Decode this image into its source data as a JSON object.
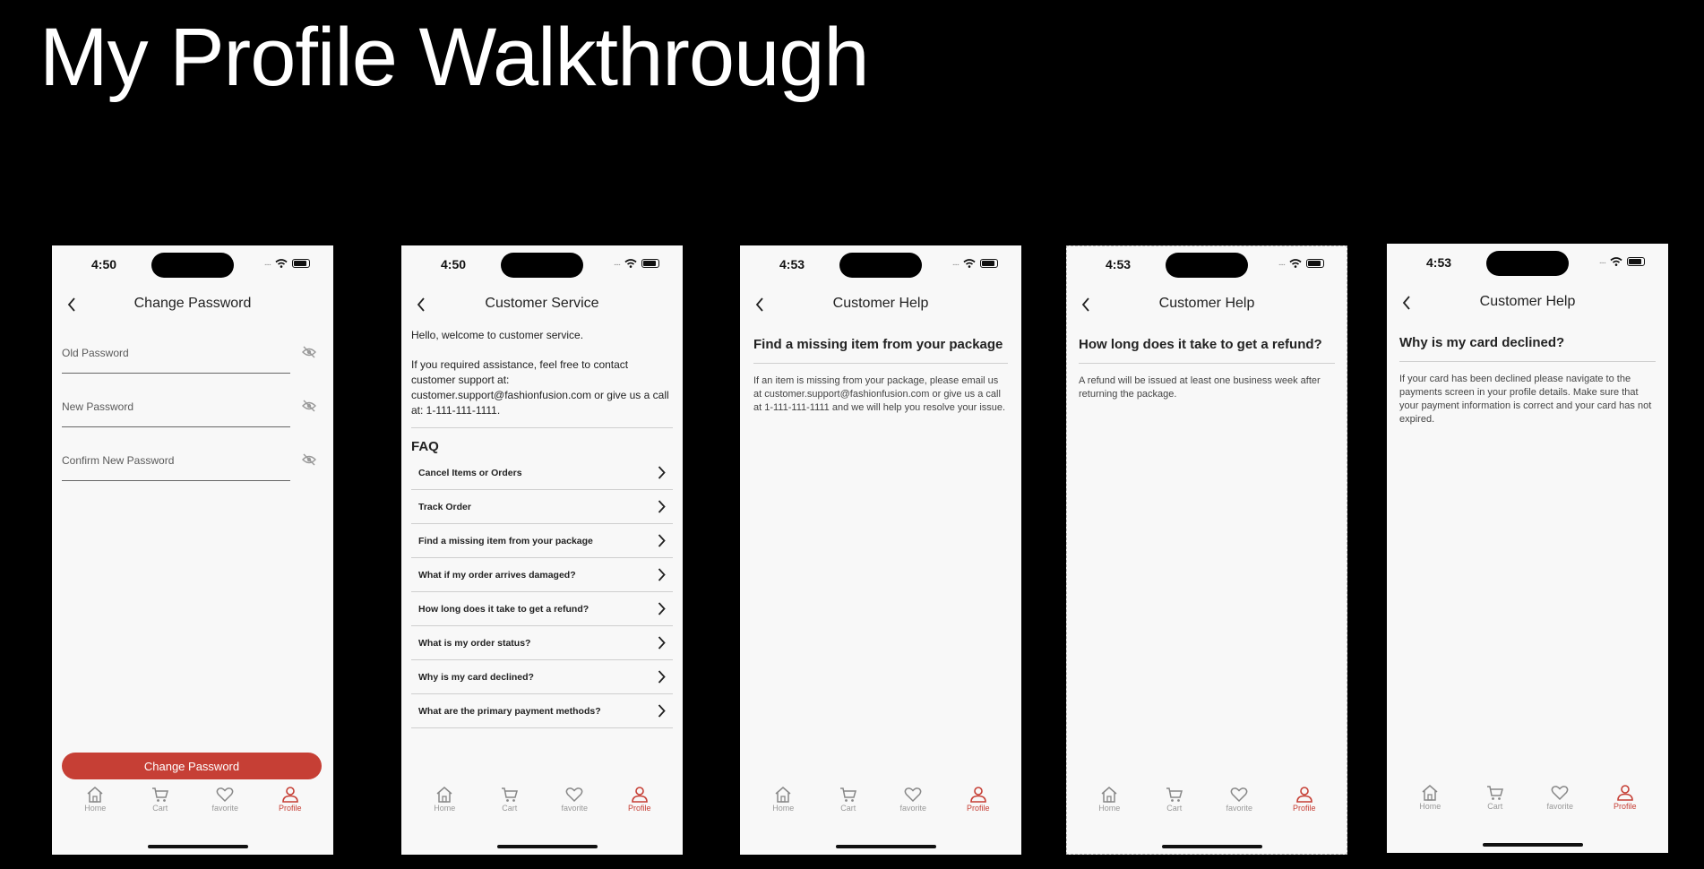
{
  "page_title": "My Profile Walkthrough",
  "colors": {
    "accent": "#c63f35",
    "background": "#000000",
    "screen": "#f8f8f8"
  },
  "tabbar": {
    "home": "Home",
    "cart": "Cart",
    "favorite": "favorite",
    "profile": "Profile",
    "active": "Profile"
  },
  "screens": [
    {
      "time": "4:50",
      "title": "Change Password",
      "fields": [
        {
          "placeholder": "Old Password"
        },
        {
          "placeholder": "New Password"
        },
        {
          "placeholder": "Confirm New Password"
        }
      ],
      "button_label": "Change Password"
    },
    {
      "time": "4:50",
      "title": "Customer Service",
      "welcome": "Hello, welcome to customer service.",
      "assistance": "If you required assistance, feel free to contact customer support at: customer.support@fashionfusion.com or give us a call at: 1-111-111-1111.",
      "faq_heading": "FAQ",
      "faq_items": [
        "Cancel Items or Orders",
        "Track Order",
        "Find a missing item from your package",
        "What if my order arrives damaged?",
        "How long does it take to get a refund?",
        "What is my order status?",
        "Why is my card declined?",
        "What are the primary payment methods?"
      ]
    },
    {
      "time": "4:53",
      "title": "Customer Help",
      "question": "Find a missing item from your package",
      "answer": "If an item is missing from your package, please email us at customer.support@fashionfusion.com or give us a call at 1-111-111-1111 and we will help you resolve your issue."
    },
    {
      "time": "4:53",
      "title": "Customer Help",
      "question": "How long does it take to get a refund?",
      "answer": "A refund will be issued at least one business week after returning the package."
    },
    {
      "time": "4:53",
      "title": "Customer Help",
      "question": "Why is my card declined?",
      "answer": "If your card has been declined please navigate to the payments screen in your profile details. Make sure that your payment information is correct and your card has not expired."
    }
  ]
}
